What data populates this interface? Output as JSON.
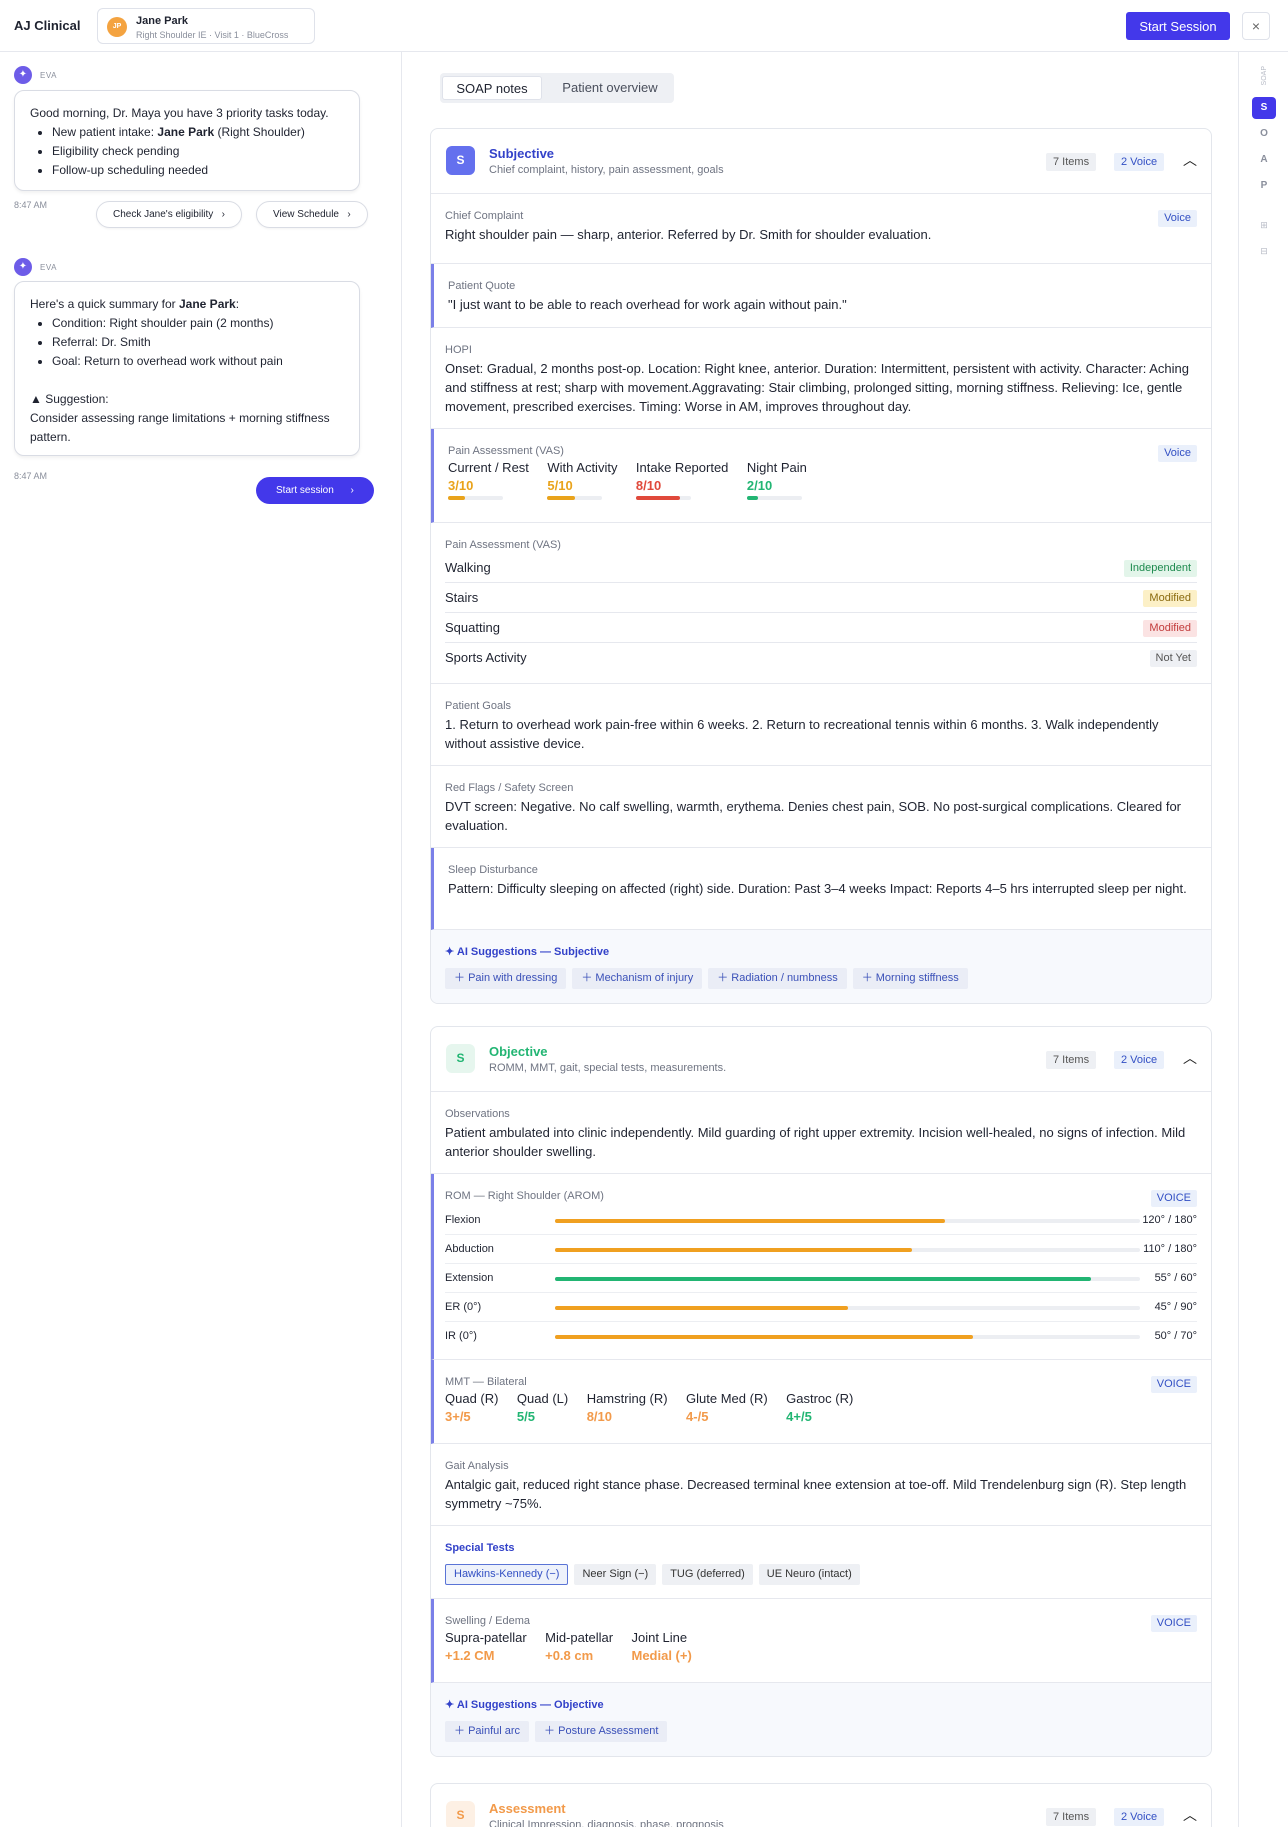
{
  "header": {
    "brand": "AJ Clinical",
    "patient": {
      "initials": "JP",
      "name": "Jane Park",
      "subtitle": "Right Shoulder IE · Visit 1 · BlueCross"
    },
    "start_session_label": "Start Session",
    "close_icon": "×"
  },
  "chat": {
    "assistant_label": "EVA",
    "message1": {
      "greeting": "Good morning, Dr. Maya you have 3 priority tasks today.",
      "items": [
        {
          "prefix": "New patient intake: ",
          "bold": "Jane Park",
          "suffix": " (Right Shoulder)"
        },
        {
          "prefix": "Eligibility check pending",
          "bold": "",
          "suffix": ""
        },
        {
          "prefix": "Follow-up scheduling needed",
          "bold": "",
          "suffix": ""
        }
      ],
      "time": "8:47 AM",
      "actions": [
        "Check Jane's eligibility",
        "View Schedule"
      ]
    },
    "message2": {
      "intro_prefix": "Here's a quick summary for ",
      "intro_bold": "Jane Park",
      "intro_suffix": ":",
      "items": [
        "Condition: Right shoulder pain (2 months)",
        "Referral: Dr. Smith",
        "Goal: Return to overhead work without pain"
      ],
      "suggestion_label": "Suggestion:",
      "suggestion_text": "Consider assessing range limitations + morning stiffness pattern.",
      "time": "8:47 AM",
      "action": "Start session"
    }
  },
  "tabs": [
    "SOAP notes",
    "Patient overview"
  ],
  "subjective": {
    "badge": "S",
    "title": "Subjective",
    "subtitle": "Chief complaint, history, pain assessment, goals",
    "items_tag": "7 Items",
    "voice_tag": "2 Voice",
    "chief_label": "Chief Complaint",
    "chief_voice": "Voice",
    "chief_text": "Right shoulder pain — sharp, anterior. Referred by Dr. Smith for shoulder evaluation.",
    "quote_label": "Patient Quote",
    "quote_text": "\"I just want to be able to reach overhead for work again without pain.\"",
    "hopi_label": "HOPI",
    "hopi_text": "Onset: Gradual, 2 months post-op. Location: Right knee, anterior. Duration: Intermittent, persistent with activity. Character: Aching and stiffness at rest; sharp with movement.Aggravating: Stair climbing, prolonged sitting, morning stiffness. Relieving: Ice, gentle movement, prescribed exercises. Timing: Worse in AM, improves throughout day.",
    "vas_label": "Pain Assessment (VAS)",
    "vas_voice": "Voice",
    "vas": [
      {
        "name": "Current / Rest",
        "value": "3/10",
        "score": 3,
        "color": "#e9a31b"
      },
      {
        "name": "With Activity",
        "value": "5/10",
        "score": 5,
        "color": "#e9a31b"
      },
      {
        "name": "Intake Reported",
        "value": "8/10",
        "score": 8,
        "color": "#e0493b"
      },
      {
        "name": "Night Pain",
        "value": "2/10",
        "score": 2,
        "color": "#22b573"
      }
    ],
    "func_label": "Pain Assessment (VAS)",
    "func": [
      {
        "name": "Walking",
        "status": "Independent",
        "bg": "#e3f5ea",
        "fg": "#1d8a4e"
      },
      {
        "name": "Stairs",
        "status": "Modified",
        "bg": "#fcf0c7",
        "fg": "#8a6a0e"
      },
      {
        "name": "Squatting",
        "status": "Modified",
        "bg": "#fbe3e3",
        "fg": "#c23b3b"
      },
      {
        "name": "Sports Activity",
        "status": "Not Yet",
        "bg": "#eef0f4",
        "fg": "#555"
      }
    ],
    "goals_label": "Patient Goals",
    "goals_text": "1. Return to overhead work pain-free within 6 weeks. 2. Return to recreational tennis within 6 months. 3. Walk independently without assistive device.",
    "flags_label": "Red Flags / Safety Screen",
    "flags_text": "DVT screen: Negative. No calf swelling, warmth, erythema. Denies chest pain, SOB. No post-surgical complications. Cleared for evaluation.",
    "sleep_label": "Sleep Disturbance",
    "sleep_text": "Pattern: Difficulty sleeping on affected (right) side. Duration: Past 3–4 weeks Impact: Reports 4–5 hrs interrupted sleep per night.",
    "ai_title": "AI Suggestions — Subjective",
    "ai_chips": [
      "Pain with dressing",
      "Mechanism of injury",
      "Radiation / numbness",
      "Morning stiffness"
    ]
  },
  "objective": {
    "badge": "S",
    "title": "Objective",
    "subtitle": "ROMM, MMT, gait, special tests, measurements.",
    "items_tag": "7 Items",
    "voice_tag": "2 Voice",
    "obs_label": "Observations",
    "obs_text": "Patient ambulated into clinic independently. Mild guarding of right upper extremity. Incision well-healed, no signs of infection. Mild anterior shoulder swelling.",
    "rom_label": "ROM — Right Shoulder (AROM)",
    "rom_voice": "VOICE",
    "rom": [
      {
        "name": "Flexion",
        "value": "120° / 180°",
        "fraction": 0.667,
        "color": "#f0a020"
      },
      {
        "name": "Abduction",
        "value": "110° / 180°",
        "fraction": 0.611,
        "color": "#f0a020"
      },
      {
        "name": "Extension",
        "value": "55° / 60°",
        "fraction": 0.917,
        "color": "#22b573"
      },
      {
        "name": "ER (0°)",
        "value": "45° / 90°",
        "fraction": 0.5,
        "color": "#f0a020"
      },
      {
        "name": "IR (0°)",
        "value": "50° / 70°",
        "fraction": 0.714,
        "color": "#f0a020"
      }
    ],
    "mmt_label": "MMT — Bilateral",
    "mmt_voice": "VOICE",
    "mmt": [
      {
        "name": "Quad (R)",
        "value": "3+/5",
        "color": "#f29a4a"
      },
      {
        "name": "Quad (L)",
        "value": "5/5",
        "color": "#22b573"
      },
      {
        "name": "Hamstring (R)",
        "value": "8/10",
        "color": "#f29a4a"
      },
      {
        "name": "Glute Med (R)",
        "value": "4-/5",
        "color": "#f29a4a"
      },
      {
        "name": "Gastroc (R)",
        "value": "4+/5",
        "color": "#22b573"
      }
    ],
    "gait_label": "Gait Analysis",
    "gait_text": "Antalgic gait, reduced right stance phase. Decreased terminal knee extension at toe-off. Mild Trendelenburg sign (R). Step length symmetry ~75%.",
    "special_label": "Special Tests",
    "special": [
      "Hawkins-Kennedy (−)",
      "Neer Sign (−)",
      "TUG (deferred)",
      "UE Neuro (intact)"
    ],
    "swell_label": "Swelling / Edema",
    "swell_voice": "VOICE",
    "swell": [
      {
        "name": "Supra-patellar",
        "value": "+1.2 CM"
      },
      {
        "name": "Mid-patellar",
        "value": "+0.8 cm"
      },
      {
        "name": "Joint Line",
        "value": "Medial (+)"
      }
    ],
    "ai_title": "AI Suggestions — Objective",
    "ai_chips": [
      "Painful arc",
      "Posture Assessment"
    ]
  },
  "assessment": {
    "badge": "S",
    "title": "Assessment",
    "subtitle": "Clinical Impression, diagnosis, phase, prognosis",
    "items_tag": "7 Items",
    "voice_tag": "2 Voice"
  },
  "rail": {
    "label": "SOAP",
    "letters": [
      "S",
      "O",
      "A",
      "P"
    ]
  },
  "colors": {
    "accent": "#4338ea",
    "subjective": "#3342c9",
    "objective": "#22b573",
    "assessment": "#f29a4a"
  }
}
